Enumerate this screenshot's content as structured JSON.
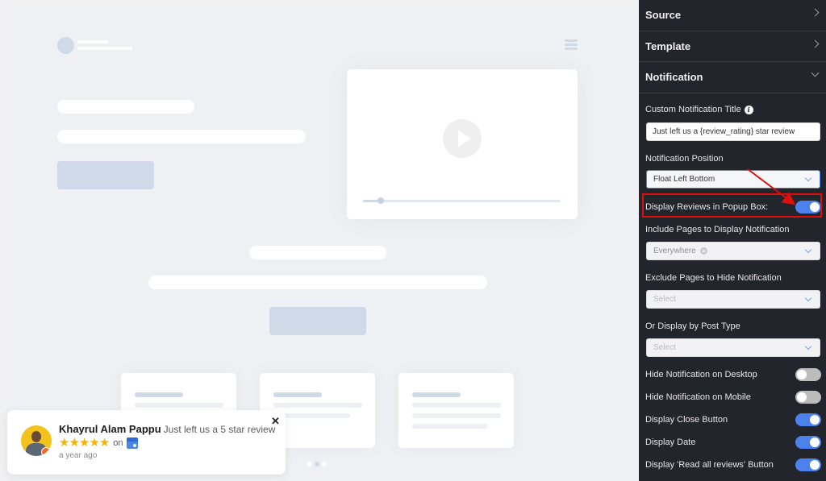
{
  "preview": {
    "video": {
      "progress_fraction": 0.09
    },
    "carousel": {
      "dot_count": 3,
      "active_index": 1
    }
  },
  "popup": {
    "name": "Khayrul Alam Pappu",
    "message": "Just left us a 5 star review",
    "rating": 5,
    "star_glyph": "★",
    "on_label": "on",
    "platform_icon": "google-my-business-icon",
    "time": "a year ago",
    "close_glyph": "✕"
  },
  "panel": {
    "sections": [
      {
        "label": "Source",
        "expanded": false
      },
      {
        "label": "Template",
        "expanded": false
      },
      {
        "label": "Notification",
        "expanded": true
      }
    ],
    "custom_title": {
      "label": "Custom Notification Title",
      "info_glyph": "i",
      "value": "Just left us a {review_rating} star review"
    },
    "position": {
      "label": "Notification Position",
      "value": "Float Left Bottom"
    },
    "display_reviews_popup": {
      "label": "Display Reviews in Popup Box:",
      "on": true
    },
    "include_pages": {
      "label": "Include Pages to Display Notification",
      "value": "Everywhere"
    },
    "exclude_pages": {
      "label": "Exclude Pages to Hide Notification",
      "placeholder": "Select"
    },
    "post_type": {
      "label": "Or Display by Post Type",
      "placeholder": "Select"
    },
    "toggles": [
      {
        "label": "Hide Notification on Desktop",
        "on": false
      },
      {
        "label": "Hide Notification on Mobile",
        "on": false
      },
      {
        "label": "Display Close Button",
        "on": true
      },
      {
        "label": "Display Date",
        "on": true
      },
      {
        "label": "Display 'Read all reviews' Button",
        "on": true
      }
    ]
  },
  "annotation": {
    "highlight_color": "#e00d0d",
    "accent_color": "#4d82ec"
  }
}
